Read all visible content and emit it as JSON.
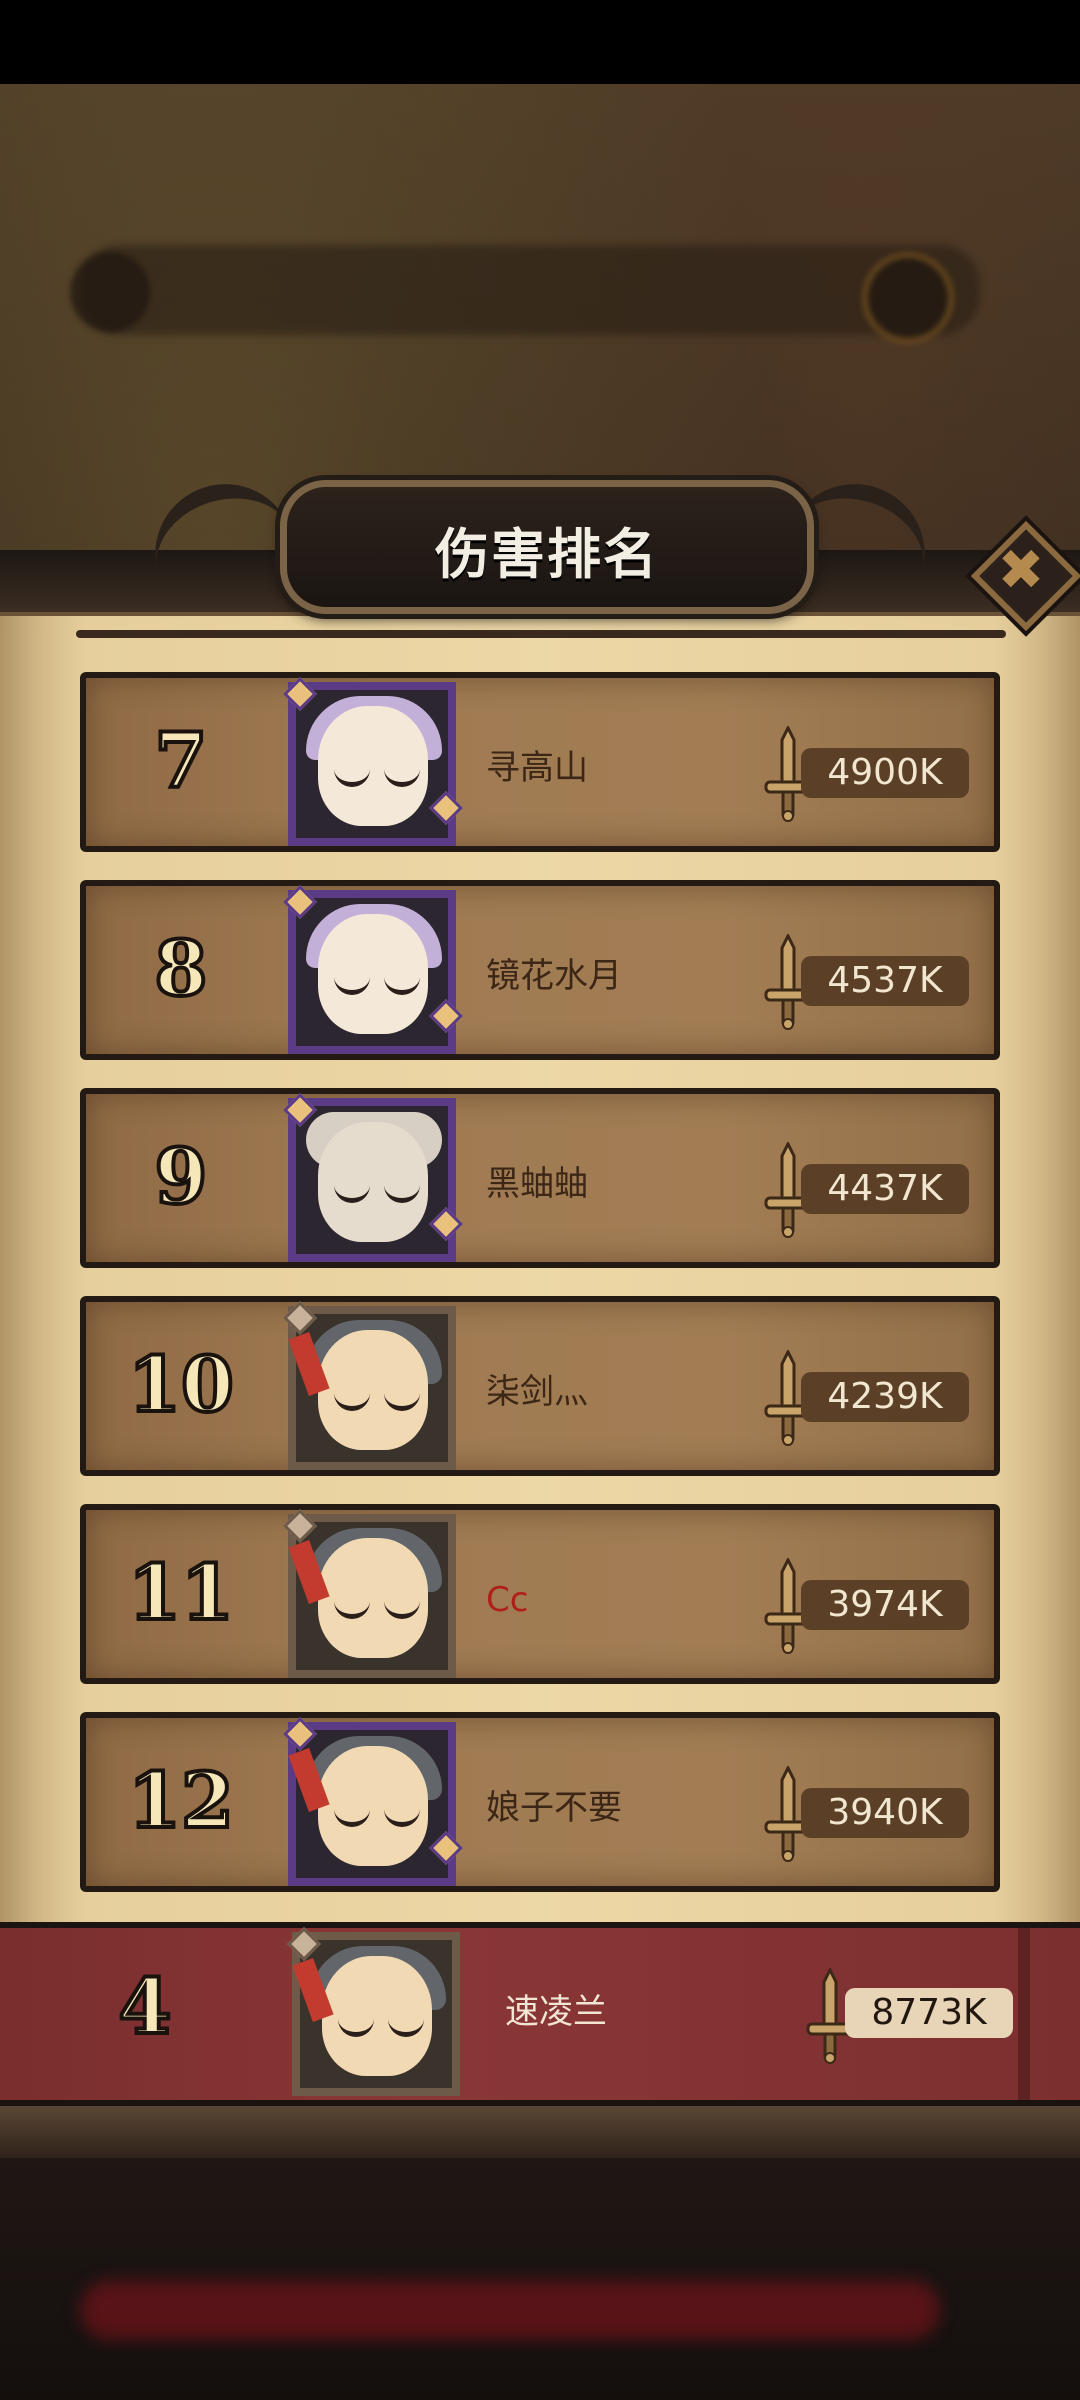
{
  "panel": {
    "title": "伤害排名",
    "close_icon": "close-x-icon"
  },
  "rankings": [
    {
      "rank": "7",
      "name": "寻高山",
      "damage": "4900K",
      "frame": "purple",
      "avatar": "lavender-hair-girl"
    },
    {
      "rank": "8",
      "name": "镜花水月",
      "damage": "4537K",
      "frame": "purple",
      "avatar": "lavender-hair-girl"
    },
    {
      "rank": "9",
      "name": "黑蚰蚰",
      "damage": "4437K",
      "frame": "purple",
      "avatar": "mummy"
    },
    {
      "rank": "10",
      "name": "柒剑灬",
      "damage": "4239K",
      "frame": "bronze",
      "avatar": "knight"
    },
    {
      "rank": "11",
      "name": "Cc",
      "damage": "3974K",
      "frame": "bronze",
      "avatar": "knight",
      "name_color": "#b0201a"
    },
    {
      "rank": "12",
      "name": "娘子不要",
      "damage": "3940K",
      "frame": "purple",
      "avatar": "knight"
    }
  ],
  "self": {
    "rank": "4",
    "name": "速凌兰",
    "damage": "8773K",
    "frame": "bronze",
    "avatar": "knight"
  },
  "colors": {
    "row_bg": "#9f7a52",
    "self_row_bg": "#8a3636",
    "purple_frame": "#5b3b86",
    "bronze_frame": "#6e5a48"
  },
  "icons": {
    "damage": "sword-icon"
  }
}
